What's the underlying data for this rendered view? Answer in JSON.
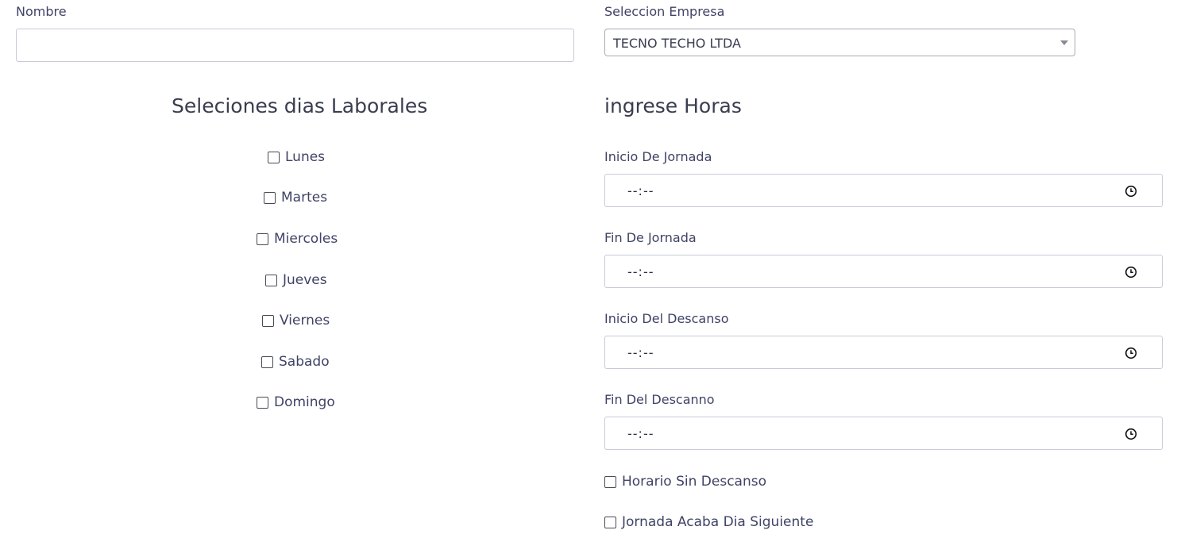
{
  "nombre": {
    "label": "Nombre",
    "value": ""
  },
  "empresa": {
    "label": "Seleccion Empresa",
    "selected": "TECNO TECHO LTDA"
  },
  "dias": {
    "heading": "Seleciones dias Laborales",
    "items": [
      {
        "label": "Lunes",
        "checked": false
      },
      {
        "label": "Martes",
        "checked": false
      },
      {
        "label": "Miercoles",
        "checked": false
      },
      {
        "label": "Jueves",
        "checked": false
      },
      {
        "label": "Viernes",
        "checked": false
      },
      {
        "label": "Sabado",
        "checked": false
      },
      {
        "label": "Domingo",
        "checked": false
      }
    ]
  },
  "horas": {
    "heading": "ingrese Horas",
    "fields": [
      {
        "label": "Inicio De Jornada",
        "placeholder": "--:--",
        "icon": "clock-icon"
      },
      {
        "label": "Fin De Jornada",
        "placeholder": "--:--",
        "icon": "clock-icon"
      },
      {
        "label": "Inicio Del Descanso",
        "placeholder": "--:--",
        "icon": "clock-icon"
      },
      {
        "label": "Fin Del Descanno",
        "placeholder": "--:--",
        "icon": "clock-icon"
      }
    ],
    "options": [
      {
        "label": "Horario Sin Descanso",
        "checked": false
      },
      {
        "label": "Jornada Acaba Dia Siguiente",
        "checked": false
      }
    ]
  },
  "colors": {
    "text": "#3f4366",
    "border": "#c8cad8"
  }
}
